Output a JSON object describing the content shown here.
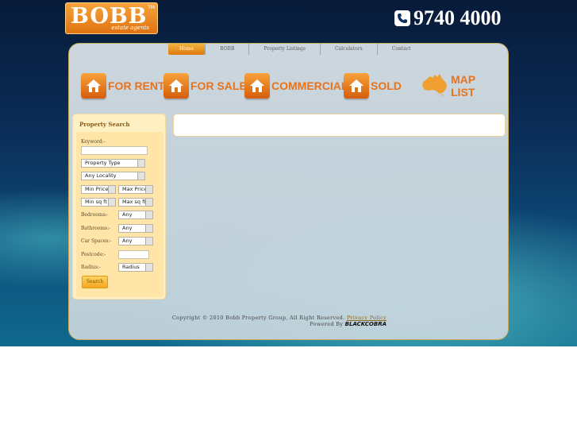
{
  "header": {
    "logo_text": "BOBB",
    "logo_tm": "TM",
    "logo_subtitle": "estate agents",
    "phone": "9740 4000"
  },
  "top_nav": [
    "Home",
    "BOBB",
    "Property Listings",
    "Calculators",
    "Contact"
  ],
  "categories": [
    "FOR RENT",
    "FOR SALE",
    "COMMERCIAL",
    "SOLD",
    "MAP LIST"
  ],
  "search": {
    "title": "Property Search",
    "keyword_label": "Keyword:-",
    "keyword_value": "",
    "property_type": "Property Type",
    "locality": "Any Locality",
    "min_price": "Min Price",
    "max_price": "Max Price",
    "min_sqft": "Min sq ft",
    "max_sqft": "Max sq ft",
    "bedrooms_label": "Bedrooms:-",
    "bedrooms_value": "Any",
    "bathrooms_label": "Bathrooms:-",
    "bathrooms_value": "Any",
    "car_spaces_label": "Car Spaces:-",
    "car_spaces_value": "Any",
    "postcode_label": "Postcode:-",
    "postcode_value": "",
    "radius_label": "Radius:-",
    "radius_value": "Radius",
    "button": "Search"
  },
  "footer": {
    "copyright": "Copyright © 2010 Bobb Property Group, All Right Reserved.",
    "privacy_link": "Privacy Policy",
    "powered_by": "Powered By",
    "powered_brand": "BLACKCOBRA"
  },
  "colors": {
    "accent": "#e8731a",
    "panel": "#d2dde3",
    "search_bg": "#ffe6a8"
  }
}
